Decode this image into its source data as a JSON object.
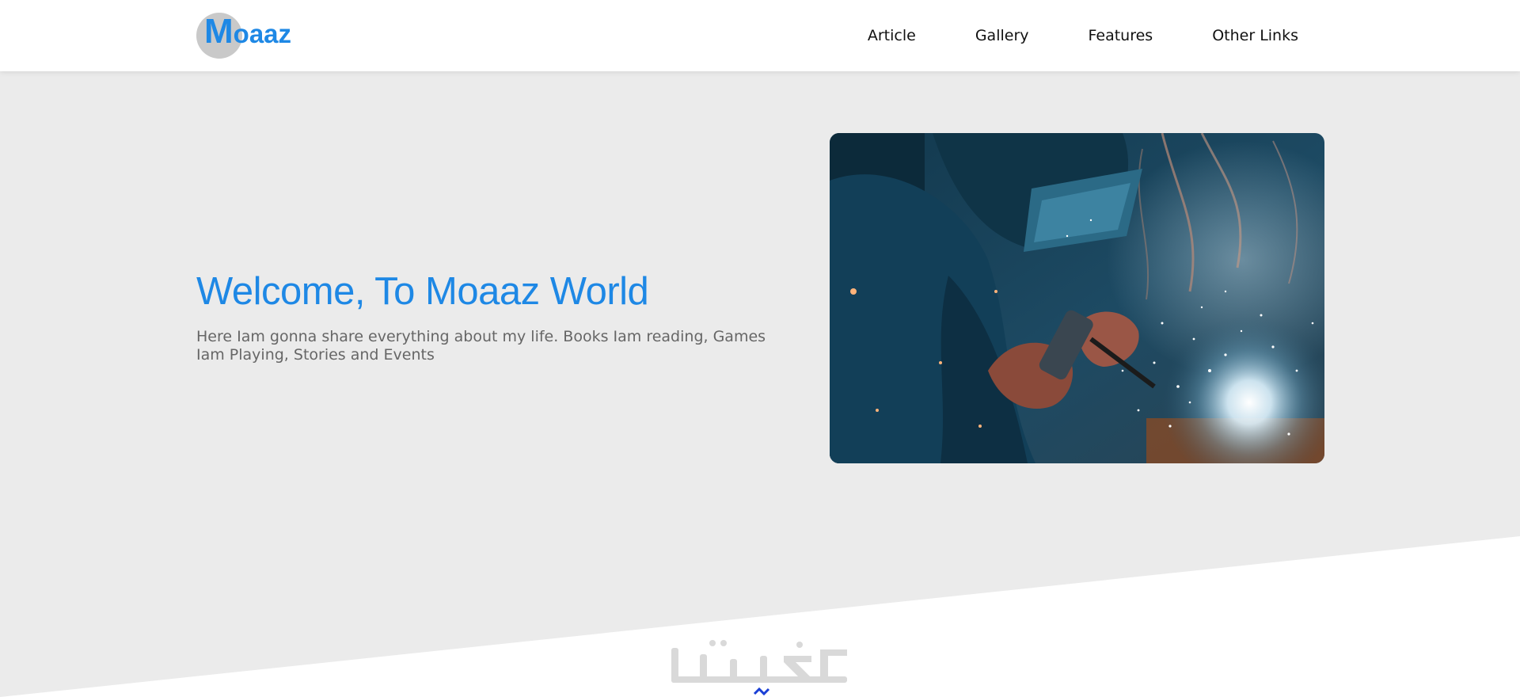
{
  "header": {
    "logo": {
      "first_letter": "M",
      "rest": "oaaz"
    },
    "nav": [
      {
        "label": "Article"
      },
      {
        "label": "Gallery"
      },
      {
        "label": "Features"
      },
      {
        "label": "Other Links"
      }
    ]
  },
  "hero": {
    "title": "Welcome, To Moaaz World",
    "description": "Here Iam gonna share everything about my life. Books Iam reading, Games Iam Playing, Stories and Events",
    "image_icon": "welder-photo"
  },
  "watermark": {
    "icon": "khamsat-logo"
  },
  "colors": {
    "accent": "#1e88e5",
    "hero_bg": "#ebebeb",
    "logo_circle": "#c9c9c9",
    "text_muted": "#666666"
  }
}
